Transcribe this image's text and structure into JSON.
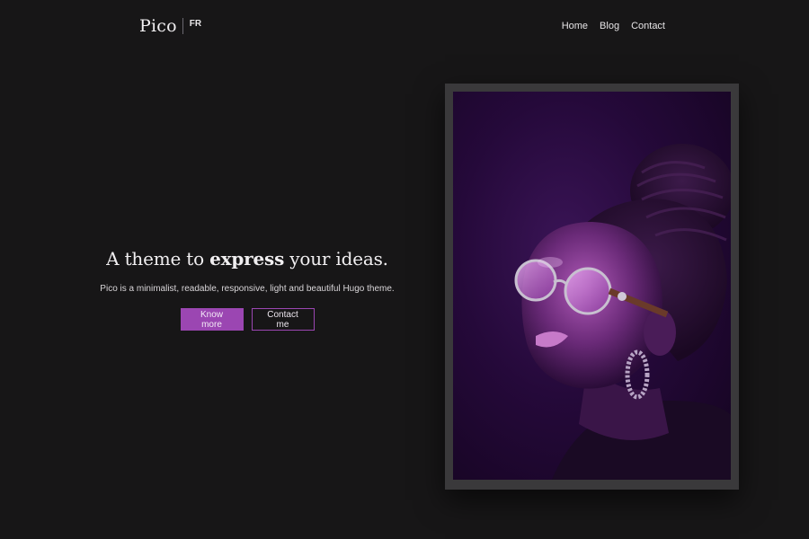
{
  "header": {
    "site_title": "Pico",
    "language_link": "FR",
    "nav": [
      {
        "label": "Home"
      },
      {
        "label": "Blog"
      },
      {
        "label": "Contact"
      }
    ]
  },
  "hero": {
    "headline_before": "A theme to ",
    "headline_emphasis": "express",
    "headline_after": " your ideas.",
    "subtitle": "Pico is a minimalist, readable, responsive, light and beautiful Hugo theme.",
    "primary_button": "Know more",
    "secondary_button": "Contact me"
  },
  "colors": {
    "background": "#171617",
    "accent": "#9b46b2",
    "frame": "#3a393b"
  }
}
